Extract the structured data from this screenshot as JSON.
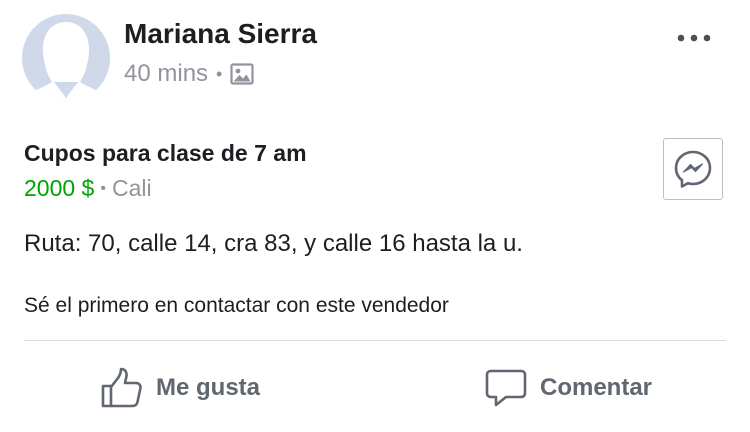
{
  "post": {
    "author_name": "Mariana Sierra",
    "timestamp": "40 mins",
    "meta_separator": "•",
    "avatar_icon": "default-avatar-silhouette",
    "privacy_icon": "photo-icon",
    "more_icon": "more-horizontal-icon"
  },
  "listing": {
    "title": "Cupos para clase de 7 am",
    "price": "2000 $",
    "separator": "•",
    "location": "Cali",
    "price_color": "#00a400",
    "message_icon": "messenger-icon"
  },
  "body": {
    "description": "Ruta: 70, calle 14, cra 83, y calle 16 hasta la u.",
    "contact_hint": "Sé el primero en contactar con este vendedor"
  },
  "actions": {
    "like_label": "Me gusta",
    "comment_label": "Comentar",
    "like_icon": "thumbs-up-icon",
    "comment_icon": "comment-bubble-icon"
  }
}
